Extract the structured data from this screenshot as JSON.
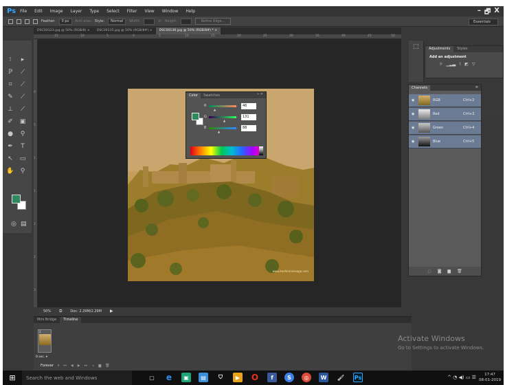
{
  "app": {
    "logo": "Ps",
    "menu": [
      "File",
      "Edit",
      "Image",
      "Layer",
      "Type",
      "Select",
      "Filter",
      "View",
      "Window",
      "Help"
    ],
    "window_controls": [
      "–",
      "🗗",
      "X"
    ]
  },
  "options": {
    "feather_label": "Feather:",
    "feather_value": "0 px",
    "antialias_label": "Anti-alias",
    "style_label": "Style:",
    "style_value": "Normal",
    "width_label": "Width:",
    "height_label": "Height:",
    "refine_label": "Refine Edge...",
    "workspace": "Essentials"
  },
  "tabs": [
    {
      "label": "DSC00123.jpg @ 50% (RGB/8) ×",
      "active": false
    },
    {
      "label": "DSC00135.jpg @ 50% (RGB/8#) ×",
      "active": false
    },
    {
      "label": "DSC00136.jpg @ 50% (RGB/8#) * ×",
      "active": true
    }
  ],
  "ruler": {
    "top_ticks": [
      "15",
      "10",
      "5",
      "0",
      "5",
      "10",
      "15",
      "20",
      "25",
      "30",
      "35",
      "40",
      "45",
      "50"
    ],
    "left_ticks": [
      "0",
      "5",
      "1",
      "1",
      "2",
      "2",
      "3"
    ]
  },
  "status": {
    "zoom": "50%",
    "doc": "Doc: 2.29M/2.29M"
  },
  "color_panel": {
    "tabs": [
      "Color",
      "Swatches"
    ],
    "colors": {
      "foreground": "#2e8a5c",
      "background": "#ffffff"
    },
    "channels": [
      {
        "name": "R",
        "value": "46"
      },
      {
        "name": "G",
        "value": "131"
      },
      {
        "name": "B",
        "value": "88"
      }
    ]
  },
  "timeline": {
    "tabs": [
      "Mini Bridge",
      "Timeline"
    ],
    "frame_number": "1",
    "frame_delay": "0 sec. ▾",
    "loop": "Forever"
  },
  "adjustments": {
    "tabs": [
      "Adjustments",
      "Styles"
    ],
    "title": "Add an adjustment"
  },
  "channels": {
    "tab": "Channels",
    "rows": [
      {
        "name": "RGB",
        "shortcut": "Ctrl+2"
      },
      {
        "name": "Red",
        "shortcut": "Ctrl+3"
      },
      {
        "name": "Green",
        "shortcut": "Ctrl+4"
      },
      {
        "name": "Blue",
        "shortcut": "Ctrl+5"
      }
    ]
  },
  "photo": {
    "watermark": "www.kashmirvisaapp.com"
  },
  "activation": {
    "title": "Activate Windows",
    "subtitle": "Go to Settings to activate Windows."
  },
  "taskbar": {
    "search": "Search the web and Windows",
    "time": "17:47",
    "date": "08-01-2019"
  }
}
